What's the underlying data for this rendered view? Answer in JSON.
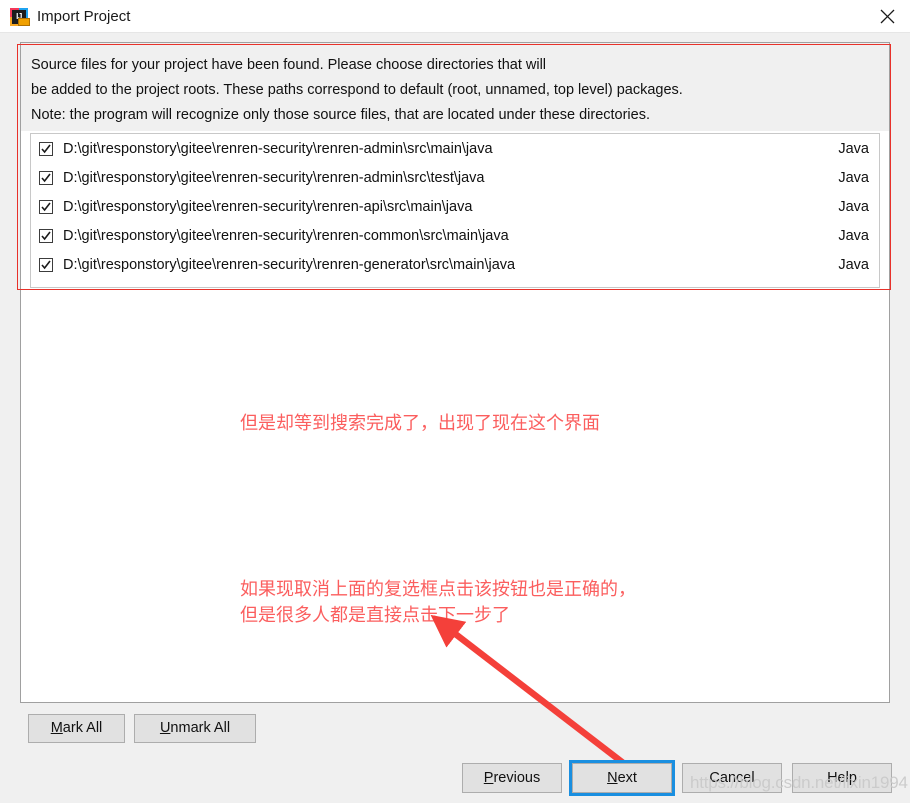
{
  "window": {
    "title": "Import Project",
    "app_icon": "intellij-idea-icon",
    "close_icon": "close-icon"
  },
  "description": {
    "lines": [
      "Source files for your project have been found. Please choose directories that will",
      "be added to the project roots. These paths correspond to default (root, unnamed, top level) packages.",
      "Note: the program will recognize only those source files, that are located under these directories."
    ]
  },
  "source_list": {
    "rows": [
      {
        "checked": true,
        "path": "D:\\git\\responstory\\gitee\\renren-security\\renren-admin\\src\\main\\java",
        "type": "Java"
      },
      {
        "checked": true,
        "path": "D:\\git\\responstory\\gitee\\renren-security\\renren-admin\\src\\test\\java",
        "type": "Java"
      },
      {
        "checked": true,
        "path": "D:\\git\\responstory\\gitee\\renren-security\\renren-api\\src\\main\\java",
        "type": "Java"
      },
      {
        "checked": true,
        "path": "D:\\git\\responstory\\gitee\\renren-security\\renren-common\\src\\main\\java",
        "type": "Java"
      },
      {
        "checked": true,
        "path": "D:\\git\\responstory\\gitee\\renren-security\\renren-generator\\src\\main\\java",
        "type": "Java"
      }
    ]
  },
  "annotations": {
    "box_color": "#e8312a",
    "text_color": "#fb5e5e",
    "note_1": "但是却等到搜索完成了，出现了现在这个界面",
    "note_2_line1": "如果现取消上面的复选框点击该按钮也是正确的，",
    "note_2_line2": "但是很多人都是直接点击下一步了",
    "arrow": "red-arrow-pointing-to-next-button"
  },
  "mark_buttons": {
    "mark_all_mnemonic": "M",
    "mark_all_rest": "ark All",
    "unmark_all_mnemonic": "U",
    "unmark_all_rest": "nmark All"
  },
  "dialog_buttons": {
    "previous_mnemonic": "P",
    "previous_rest": "revious",
    "next_mnemonic": "N",
    "next_rest": "ext",
    "cancel": "Cancel",
    "help": "Help",
    "focused": "Next",
    "focus_color": "#1a8fe0"
  },
  "watermark": {
    "text": "https://blog.csdn.net/lixin1994"
  }
}
